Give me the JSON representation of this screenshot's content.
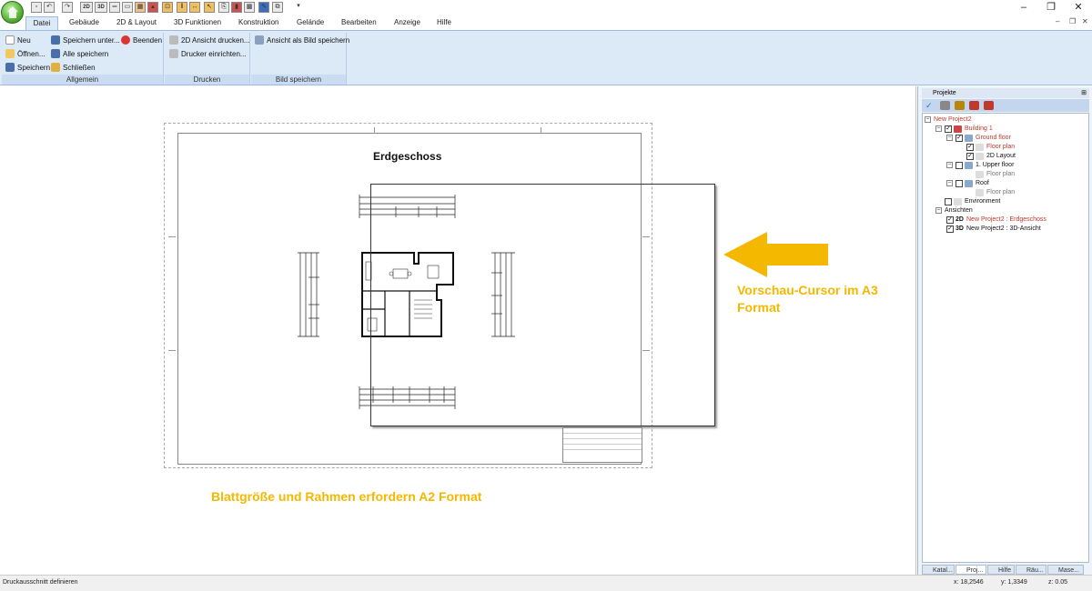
{
  "quick_access": [
    "new",
    "undo",
    "redo",
    "2D",
    "3D",
    "walls",
    "stairs",
    "roof",
    "door",
    "window",
    "measure",
    "select",
    "copy",
    "paint",
    "dropdown"
  ],
  "window_controls": {
    "minimize": "–",
    "restore": "❐",
    "close": "✕"
  },
  "tabs": [
    {
      "label": "Datei",
      "active": true
    },
    {
      "label": "Gebäude"
    },
    {
      "label": "2D & Layout"
    },
    {
      "label": "3D Funktionen"
    },
    {
      "label": "Konstruktion"
    },
    {
      "label": "Gelände"
    },
    {
      "label": "Bearbeiten"
    },
    {
      "label": "Anzeige"
    },
    {
      "label": "Hilfe"
    }
  ],
  "ribbon": {
    "allgemein": {
      "label": "Allgemein",
      "neu": "Neu",
      "oeffnen": "Öffnen...",
      "speichern": "Speichern",
      "speichern_unter": "Speichern unter...",
      "alle_speichern": "Alle speichern",
      "schliessen": "Schließen",
      "beenden": "Beenden"
    },
    "drucken": {
      "label": "Drucken",
      "ansicht_drucken": "2D Ansicht drucken...",
      "drucker_einrichten": "Drucker einrichten..."
    },
    "bild": {
      "label": "Bild speichern",
      "ansicht_als_bild": "Ansicht als Bild speichern"
    }
  },
  "canvas": {
    "drawing_title": "Erdgeschoss",
    "annotation_a3": "Vorschau-Cursor im A3 Format",
    "annotation_a3_line1": "Vorschau-Cursor im A3",
    "annotation_a3_line2": "Format",
    "annotation_a2": "Blattgröße und Rahmen erfordern A2 Format",
    "arrow_color": "#f5b800"
  },
  "panel": {
    "title": "Projekte",
    "tree": {
      "project": "New Project2",
      "building": "Building 1",
      "ground_floor": "Ground floor",
      "floor_plan_1": "Floor plan",
      "layout_2d": "2D Layout",
      "upper_floor": "1. Upper floor",
      "floor_plan_2": "Floor plan",
      "roof": "Roof",
      "floor_plan_3": "Floor plan",
      "environment": "Environment",
      "ansichten": "Ansichten",
      "view_2d_tag": "2D",
      "view_2d": "New Project2 : Erdgeschoss",
      "view_3d_tag": "3D",
      "view_3d": "New Project2 : 3D-Ansicht"
    },
    "bottom_tabs": [
      "Katal...",
      "Proj...",
      "Hilfe",
      "Räu...",
      "Mase..."
    ]
  },
  "status": {
    "message": "Druckausschnitt definieren",
    "x": "x: 18,2546",
    "y": "y: 1,3349",
    "z": "z: 0.05"
  }
}
